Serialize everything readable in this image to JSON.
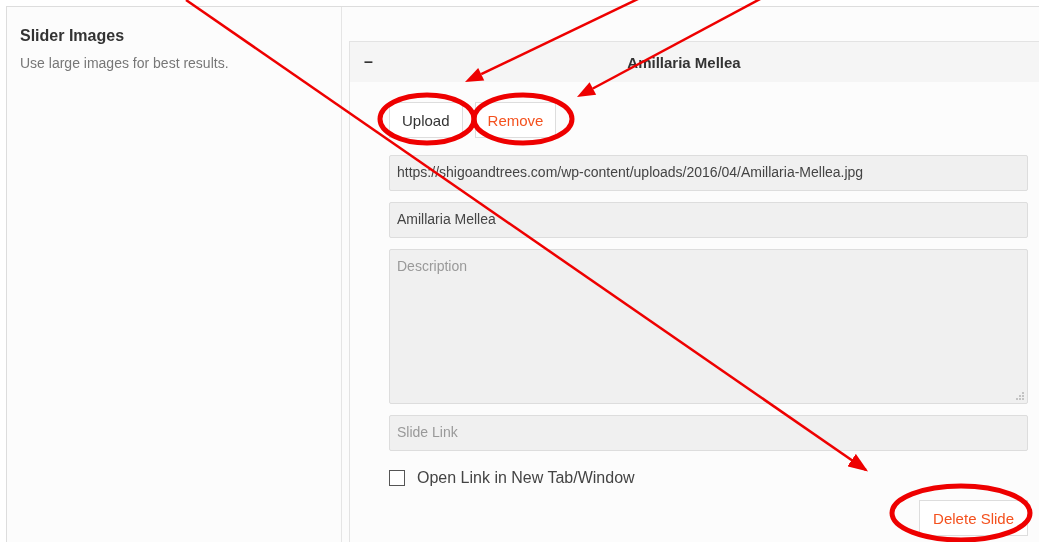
{
  "section": {
    "title": "Slider Images",
    "description": "Use large images for best results."
  },
  "slide": {
    "toggle": "–",
    "title": "Amillaria Mellea",
    "expanded": true,
    "buttons": [
      {
        "label": "Upload",
        "kind": "normal"
      },
      {
        "label": "Remove",
        "kind": "danger"
      }
    ],
    "image_url": {
      "value": "https://shigoandtrees.com/wp-content/uploads/2016/04/Amillaria-Mellea.jpg"
    },
    "name": {
      "value": "Amillaria Mellea"
    },
    "description": {
      "placeholder": "Description"
    },
    "link": {
      "placeholder": "Slide Link"
    },
    "new_tab": {
      "label": "Open Link in New Tab/Window",
      "checked": false
    },
    "delete": {
      "label": "Delete Slide"
    }
  }
}
